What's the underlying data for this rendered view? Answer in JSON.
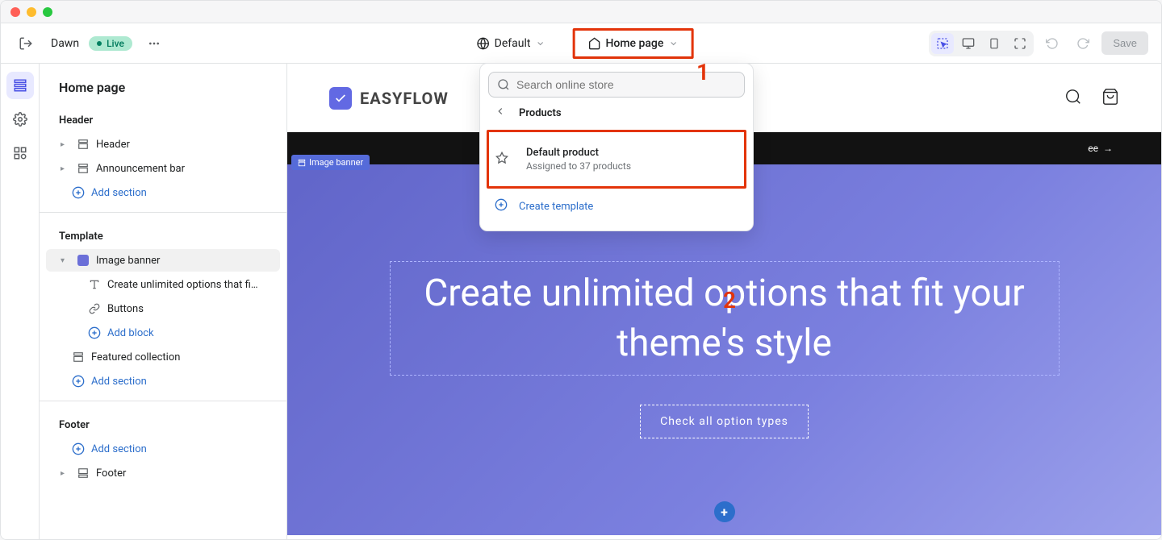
{
  "window": {
    "theme_name": "Dawn",
    "live_badge": "Live"
  },
  "topbar": {
    "style_dropdown": "Default",
    "page_dropdown": "Home page",
    "save_label": "Save"
  },
  "annotations": {
    "one": "1",
    "two": "2"
  },
  "sidebar": {
    "title": "Home page",
    "groups": {
      "header": {
        "label": "Header",
        "items": [
          "Header",
          "Announcement bar"
        ],
        "add": "Add section"
      },
      "template": {
        "label": "Template",
        "items": [
          {
            "label": "Image banner",
            "children": [
              "Create unlimited options that fit ...",
              "Buttons"
            ],
            "add_block": "Add block"
          },
          {
            "label": "Featured collection"
          }
        ],
        "add": "Add section"
      },
      "footer": {
        "label": "Footer",
        "add": "Add section",
        "items": [
          "Footer"
        ]
      }
    }
  },
  "popup": {
    "search_placeholder": "Search online store",
    "back_label": "Products",
    "item": {
      "title": "Default product",
      "subtitle": "Assigned to 37 products"
    },
    "create": "Create template"
  },
  "preview": {
    "brand": "EASYFLOW",
    "announcement_tail": "ee",
    "banner_tag": "Image banner",
    "banner_heading": "Create unlimited options that fit your theme's style",
    "banner_cta": "Check all option types"
  }
}
